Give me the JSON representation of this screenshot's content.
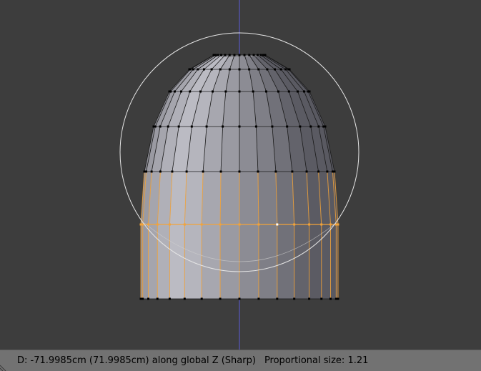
{
  "status_bar": {
    "transform_info": "D: -71.9985cm (71.9985cm) along global Z (Sharp)",
    "proportional_size": "Proportional size: 1.21"
  },
  "viewport": {
    "colors": {
      "background": "#3d3d3d",
      "z_axis": "#5b5bd6",
      "selected_edge": "#f2a33a",
      "active_vertex": "#ffffff",
      "vertex": "#000000",
      "proportional_circle": "#e6e6e6",
      "mesh_light": "#b4b4b4",
      "mesh_dark": "#4e4e56"
    },
    "icons": [
      "resize-corner-icon"
    ]
  }
}
